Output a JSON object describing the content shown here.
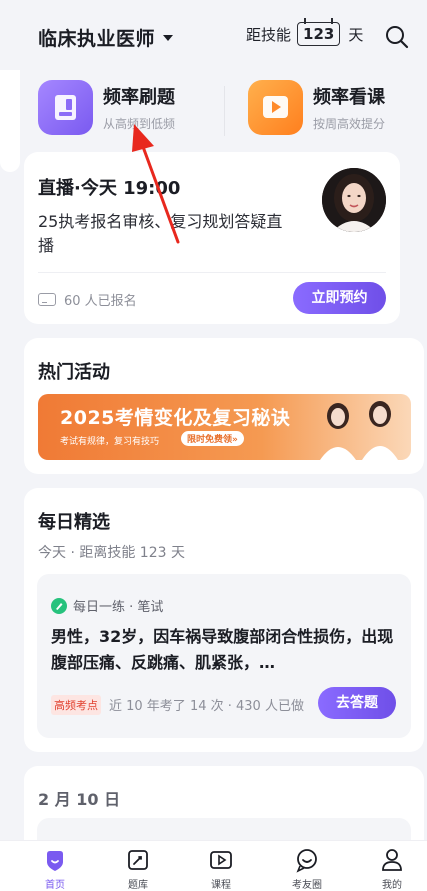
{
  "header": {
    "exam_title": "临床执业医师",
    "countdown_prefix": "距技能",
    "countdown_days": "123",
    "countdown_suffix": "天"
  },
  "entries": [
    {
      "name": "频率刷题",
      "sub": "从高频到低频",
      "icon": "practice-icon",
      "color": "#8b6cf7"
    },
    {
      "name": "频率看课",
      "sub": "按周高效提分",
      "icon": "video-play-icon",
      "color": "#ff9433"
    }
  ],
  "live": {
    "title": "直播·今天 19:00",
    "desc": "25执考报名审核、复习规划答疑直播",
    "enroll": "60 人已报名",
    "reserve_label": "立即预约"
  },
  "activity": {
    "title": "热门活动",
    "banner_title": "2025考情变化及复习秘诀",
    "banner_sub": "考试有规律，复习有技巧",
    "banner_tag": "限时免费领»"
  },
  "daily": {
    "title": "每日精选",
    "subtitle": "今天 · 距离技能 123 天",
    "source": "每日一练 · 笔试",
    "question": "男性，32岁，因车祸导致腹部闭合性损伤，出现腹部压痛、反跳痛、肌紧张，…",
    "tag": "高频考点",
    "stats": "近 10 年考了 14 次 · 430 人已做",
    "answer_label": "去答题"
  },
  "date_section": {
    "title": "2 月 10 日"
  },
  "tabbar": [
    {
      "label": "首页",
      "icon": "home-icon",
      "active": true
    },
    {
      "label": "题库",
      "icon": "question-bank-icon",
      "active": false
    },
    {
      "label": "课程",
      "icon": "course-play-icon",
      "active": false
    },
    {
      "label": "考友圈",
      "icon": "community-icon",
      "active": false
    },
    {
      "label": "我的",
      "icon": "profile-icon",
      "active": false
    }
  ],
  "colors": {
    "accent": "#7a5af0",
    "orange": "#f07a35",
    "tag_red": "#e2412f",
    "annotation_red": "#e8281e"
  }
}
